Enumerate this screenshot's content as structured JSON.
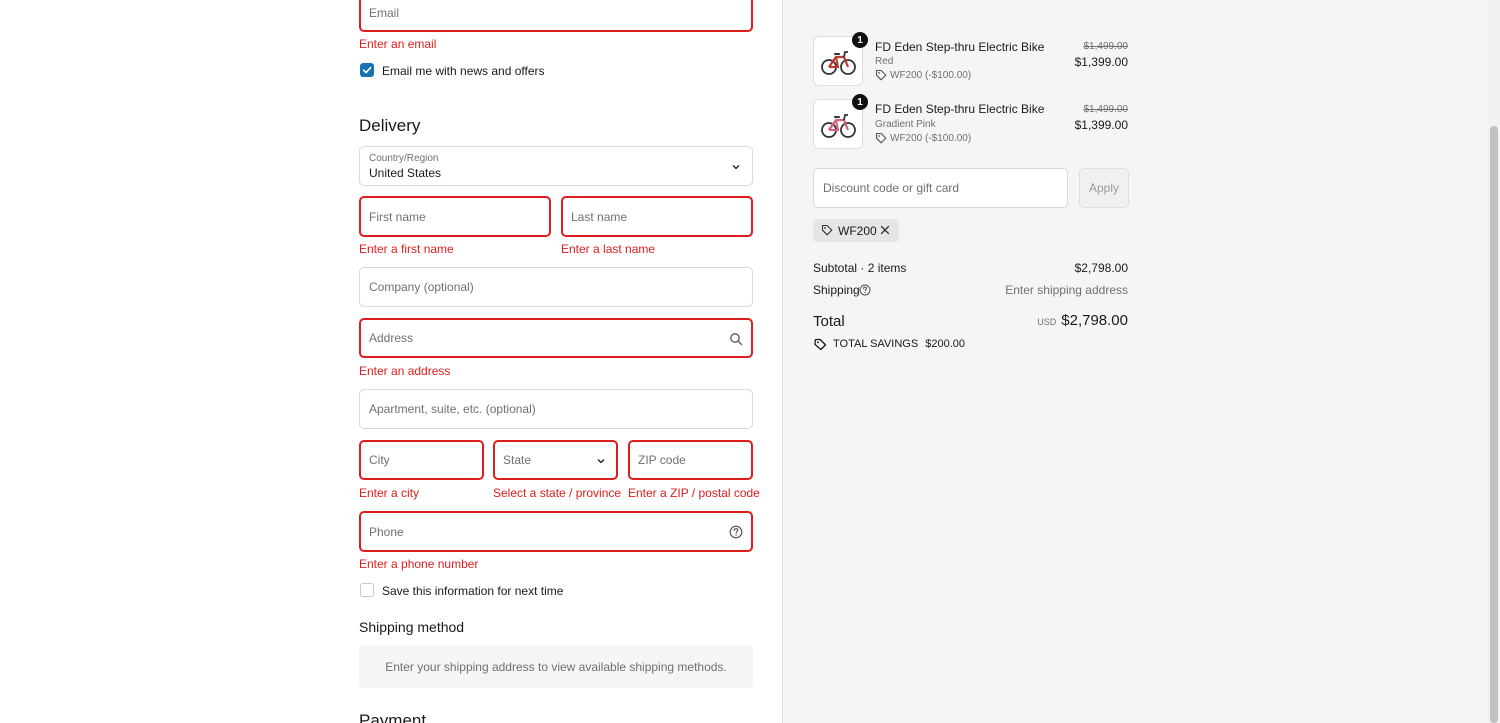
{
  "contact": {
    "email_placeholder": "Email",
    "email_error": "Enter an email",
    "news_label": "Email me with news and offers",
    "news_checked": true
  },
  "delivery": {
    "title": "Delivery",
    "country_label": "Country/Region",
    "country_value": "United States",
    "first_name_placeholder": "First name",
    "first_name_error": "Enter a first name",
    "last_name_placeholder": "Last name",
    "last_name_error": "Enter a last name",
    "company_placeholder": "Company (optional)",
    "address_placeholder": "Address",
    "address_error": "Enter an address",
    "apartment_placeholder": "Apartment, suite, etc. (optional)",
    "city_placeholder": "City",
    "city_error": "Enter a city",
    "state_placeholder": "State",
    "state_error": "Select a state / province",
    "zip_placeholder": "ZIP code",
    "zip_error": "Enter a ZIP / postal code",
    "phone_placeholder": "Phone",
    "phone_error": "Enter a phone number",
    "save_info_label": "Save this information for next time",
    "save_info_checked": false
  },
  "shipping_method": {
    "title": "Shipping method",
    "notice": "Enter your shipping address to view available shipping methods."
  },
  "payment": {
    "title": "Payment"
  },
  "summary": {
    "items": [
      {
        "quantity": "1",
        "name": "FD Eden Step-thru Electric Bike",
        "variant": "Red",
        "discount": "WF200 (-$100.00)",
        "original_price": "$1,499.00",
        "price": "$1,399.00"
      },
      {
        "quantity": "1",
        "name": "FD Eden Step-thru Electric Bike",
        "variant": "Gradient Pink",
        "discount": "WF200 (-$100.00)",
        "original_price": "$1,499.00",
        "price": "$1,399.00"
      }
    ],
    "discount_placeholder": "Discount code or gift card",
    "apply_label": "Apply",
    "applied_code": "WF200",
    "subtotal_label": "Subtotal · 2 items",
    "subtotal_value": "$2,798.00",
    "shipping_label": "Shipping",
    "shipping_value": "Enter shipping address",
    "total_label": "Total",
    "currency": "USD",
    "total_value": "$2,798.00",
    "savings_label": "TOTAL SAVINGS",
    "savings_value": "$200.00"
  },
  "colors": {
    "error": "#dd1d1d",
    "accent": "#1773b0",
    "summary_bg": "#f5f5f5"
  }
}
